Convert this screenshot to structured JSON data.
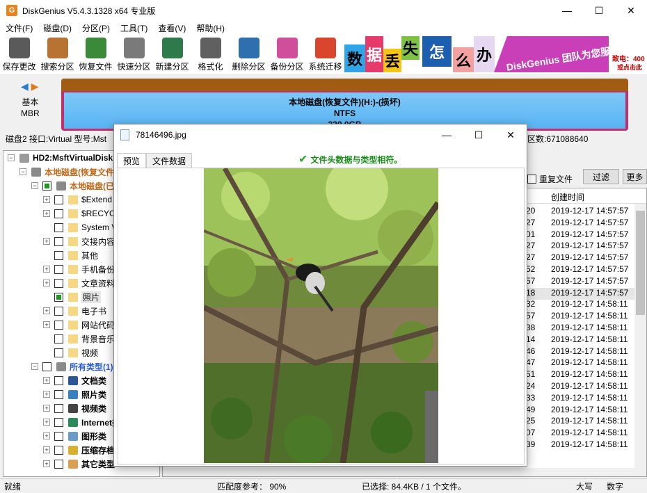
{
  "app": {
    "title": "DiskGenius V5.4.3.1328 x64 专业版",
    "icon_letter": "G"
  },
  "window_controls": {
    "minimize": "—",
    "maximize": "☐",
    "close": "✕"
  },
  "menu": [
    "文件(F)",
    "磁盘(D)",
    "分区(P)",
    "工具(T)",
    "查看(V)",
    "帮助(H)"
  ],
  "toolbar": [
    {
      "label": "保存更改",
      "icon": "save-icon",
      "color": "#5a5a5a"
    },
    {
      "label": "搜索分区",
      "icon": "magnifier-icon",
      "color": "#b87333"
    },
    {
      "label": "恢复文件",
      "icon": "recover-box-icon",
      "color": "#3a8a3a"
    },
    {
      "label": "快速分区",
      "icon": "quick-partition-icon",
      "color": "#7a7a7a"
    },
    {
      "label": "新建分区",
      "icon": "new-partition-icon",
      "color": "#2f7a4a"
    },
    {
      "label": "格式化",
      "icon": "format-icon",
      "color": "#606060"
    },
    {
      "label": "删除分区",
      "icon": "trash-icon",
      "color": "#2e6fb0"
    },
    {
      "label": "备份分区",
      "icon": "backup-icon",
      "color": "#d04f9a"
    },
    {
      "label": "系统迁移",
      "icon": "migrate-icon",
      "color": "#d9452d"
    }
  ],
  "banner": {
    "chars": [
      "数",
      "据",
      "丢",
      "失",
      "怎",
      "么",
      "办"
    ],
    "slogan": "DiskGenius 团队为您服务",
    "phone": "致电：400",
    "click": "或点击此按"
  },
  "diskmap": {
    "nav_left": "◀",
    "nav_right": "▶",
    "disk_type_line1": "基本",
    "disk_type_line2": "MBR",
    "partition_name": "本地磁盘(恢复文件)(H:)-(损坏)",
    "partition_fs": "NTFS",
    "partition_size": "320.0GB"
  },
  "diskinfo": {
    "text": "磁盘2 接口:Virtual  型号:Mst",
    "sectors": "区数:671088640"
  },
  "tree": [
    {
      "label": "HD2:MsftVirtualDisk",
      "indent": 0,
      "exp": "−",
      "checkbox": false,
      "icon": "hdd-icon",
      "bold": true,
      "color": "#000"
    },
    {
      "label": "本地磁盘(恢复文件)",
      "indent": 1,
      "exp": "−",
      "checkbox": false,
      "icon": "partition-icon",
      "bold": true,
      "color": "#c06a1a"
    },
    {
      "label": "本地磁盘(已识",
      "indent": 2,
      "exp": "−",
      "checkbox": true,
      "partial": true,
      "icon": "partition-icon",
      "bold": true,
      "color": "#c06a1a"
    },
    {
      "label": "$Extend",
      "indent": 3,
      "exp": "+",
      "checkbox": true,
      "icon": "folder-icon"
    },
    {
      "label": "$RECYCLI",
      "indent": 3,
      "exp": "+",
      "checkbox": true,
      "icon": "folder-icon"
    },
    {
      "label": "System V",
      "indent": 3,
      "exp": "",
      "checkbox": true,
      "icon": "folder-icon"
    },
    {
      "label": "交接内容",
      "indent": 3,
      "exp": "+",
      "checkbox": true,
      "icon": "folder-icon"
    },
    {
      "label": "其他",
      "indent": 3,
      "exp": "",
      "checkbox": true,
      "icon": "folder-icon"
    },
    {
      "label": "手机备份",
      "indent": 3,
      "exp": "+",
      "checkbox": true,
      "icon": "folder-icon"
    },
    {
      "label": "文章资料",
      "indent": 3,
      "exp": "+",
      "checkbox": true,
      "icon": "folder-icon"
    },
    {
      "label": "照片",
      "indent": 3,
      "exp": "",
      "checkbox": true,
      "partial": true,
      "icon": "folder-icon",
      "selected": true
    },
    {
      "label": "电子书",
      "indent": 3,
      "exp": "+",
      "checkbox": true,
      "icon": "folder-icon"
    },
    {
      "label": "网站代码",
      "indent": 3,
      "exp": "+",
      "checkbox": true,
      "icon": "folder-icon"
    },
    {
      "label": "背景音乐",
      "indent": 3,
      "exp": "",
      "checkbox": true,
      "icon": "folder-icon"
    },
    {
      "label": "视频",
      "indent": 3,
      "exp": "",
      "checkbox": true,
      "icon": "folder-icon"
    },
    {
      "label": "所有类型(1)",
      "indent": 2,
      "exp": "−",
      "checkbox": true,
      "icon": "partition-icon",
      "bold": true,
      "color": "#2a5bd7"
    },
    {
      "label": "文档类",
      "indent": 3,
      "exp": "+",
      "checkbox": true,
      "icon": "word-icon",
      "bold": true
    },
    {
      "label": "照片类",
      "indent": 3,
      "exp": "+",
      "checkbox": true,
      "icon": "photo-icon",
      "bold": true
    },
    {
      "label": "视频类",
      "indent": 3,
      "exp": "+",
      "checkbox": true,
      "icon": "video-icon",
      "bold": true
    },
    {
      "label": "Internet类",
      "indent": 3,
      "exp": "+",
      "checkbox": true,
      "icon": "globe-icon",
      "bold": true
    },
    {
      "label": "图形类",
      "indent": 3,
      "exp": "+",
      "checkbox": true,
      "icon": "image-icon",
      "bold": true
    },
    {
      "label": "压缩存档类",
      "indent": 3,
      "exp": "+",
      "checkbox": true,
      "icon": "archive-icon",
      "bold": true
    },
    {
      "label": "其它类型",
      "indent": 3,
      "exp": "+",
      "checkbox": true,
      "icon": "other-icon",
      "bold": true
    }
  ],
  "rightpanel": {
    "dup_label": "重复文件",
    "filter_label": "过滤",
    "more_label": "更多",
    "col_created": "创建时间",
    "rows": [
      {
        "c1": "20",
        "c2": "2019-12-17 14:57:57"
      },
      {
        "c1": "27",
        "c2": "2019-12-17 14:57:57"
      },
      {
        "c1": "01",
        "c2": "2019-12-17 14:57:57"
      },
      {
        "c1": "27",
        "c2": "2019-12-17 14:57:57"
      },
      {
        "c1": "27",
        "c2": "2019-12-17 14:57:57"
      },
      {
        "c1": "52",
        "c2": "2019-12-17 14:57:57"
      },
      {
        "c1": "57",
        "c2": "2019-12-17 14:57:57"
      },
      {
        "c1": "18",
        "c2": "2019-12-17 14:57:57",
        "selected": true
      },
      {
        "c1": "32",
        "c2": "2019-12-17 14:58:11"
      },
      {
        "c1": "57",
        "c2": "2019-12-17 14:58:11"
      },
      {
        "c1": "38",
        "c2": "2019-12-17 14:58:11"
      },
      {
        "c1": "14",
        "c2": "2019-12-17 14:58:11"
      },
      {
        "c1": "46",
        "c2": "2019-12-17 14:58:11"
      },
      {
        "c1": "47",
        "c2": "2019-12-17 14:58:11"
      },
      {
        "c1": "51",
        "c2": "2019-12-17 14:58:11"
      },
      {
        "c1": "24",
        "c2": "2019-12-17 14:58:11"
      },
      {
        "c1": "33",
        "c2": "2019-12-17 14:58:11"
      },
      {
        "c1": "49",
        "c2": "2019-12-17 14:58:11"
      },
      {
        "c1": "25",
        "c2": "2019-12-17 14:58:11"
      },
      {
        "c1": "07",
        "c2": "2019-12-17 14:58:11"
      },
      {
        "c1": "39",
        "c2": "2019-12-17 14:58:11"
      }
    ]
  },
  "dialog": {
    "title": "78146496.jpg",
    "tab_preview": "预览",
    "tab_data": "文件数据",
    "check_message": "文件头数据与类型相符。",
    "check_mark": "✔"
  },
  "status": {
    "ready": "就绪",
    "match": "匹配度参考：  90%",
    "selected": "已选择: 84.4KB / 1 个文件。",
    "caps": "大写",
    "num": "数字"
  }
}
